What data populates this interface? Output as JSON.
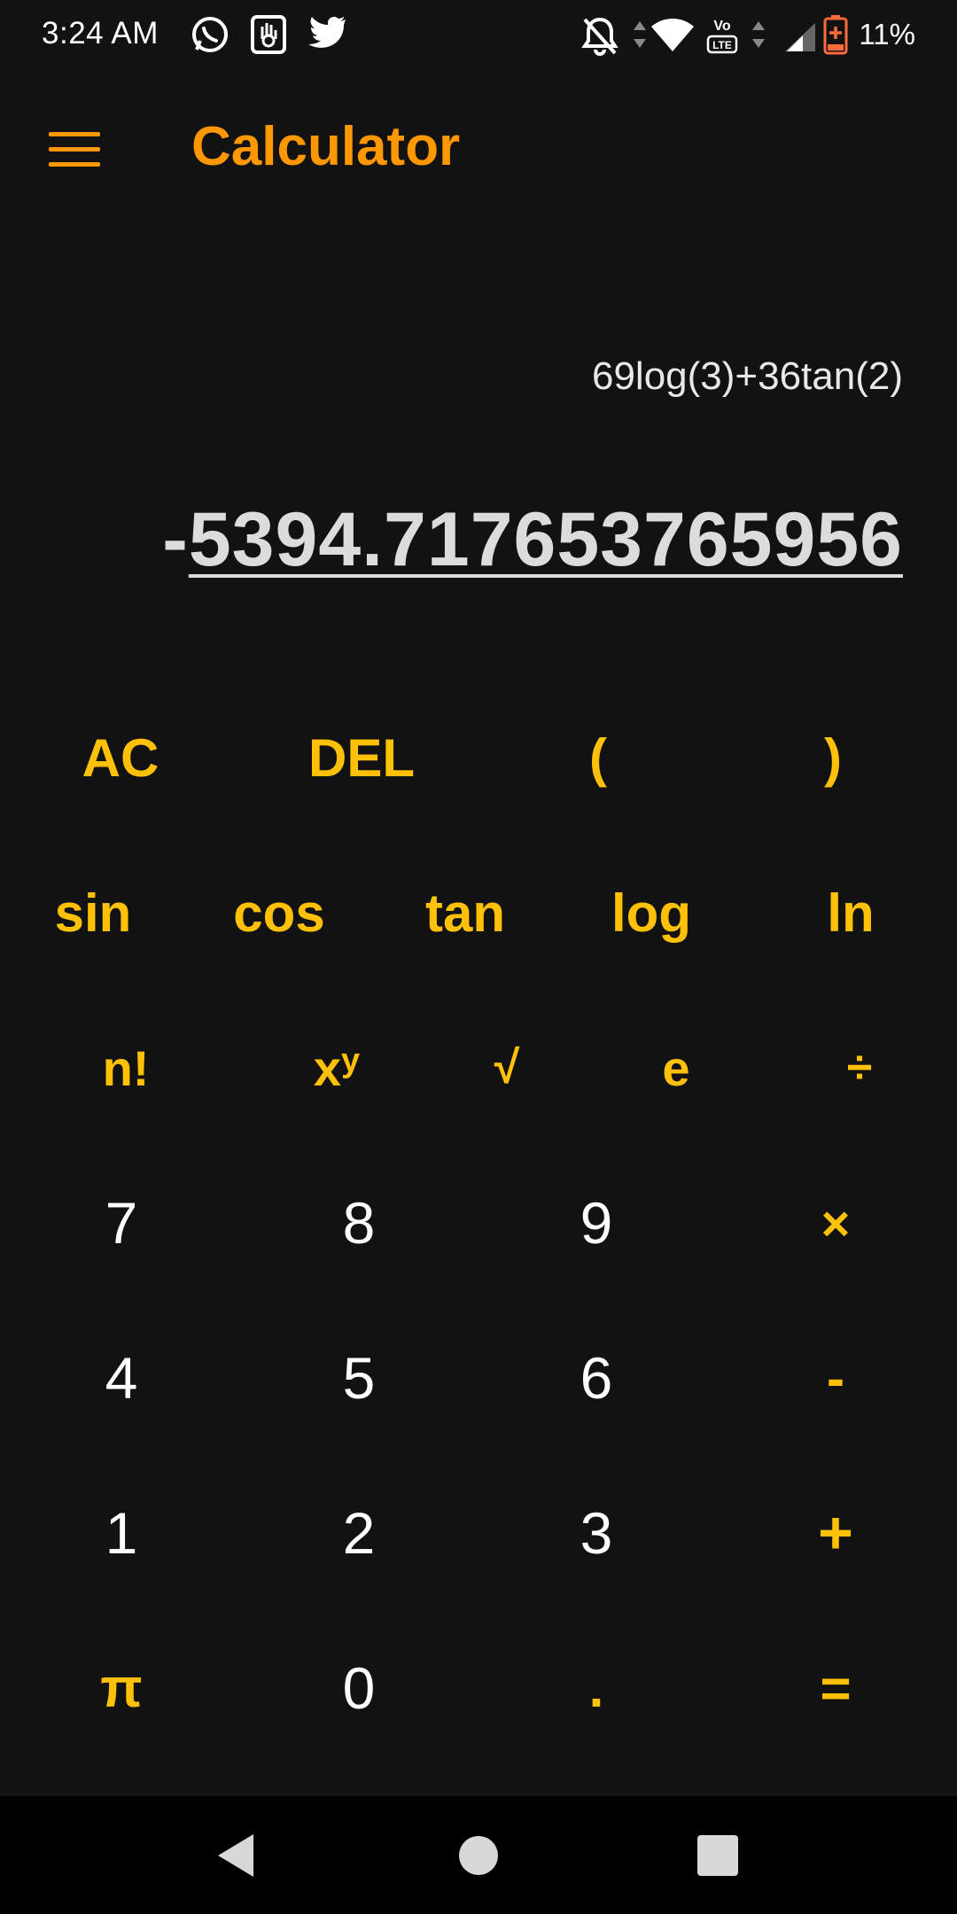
{
  "status_bar": {
    "time": "3:24 AM",
    "battery_percent": "11%",
    "icons": [
      "whatsapp-icon",
      "hand-icon",
      "twitter-icon",
      "notifications-off-icon",
      "data-arrows-icon",
      "wifi-icon",
      "volte-icon",
      "signal-icon",
      "battery-icon"
    ]
  },
  "app_bar": {
    "title": "Calculator",
    "menu_icon": "menu-icon"
  },
  "display": {
    "expression": "69log(3)+36tan(2)",
    "result_sign": "-",
    "result_value": "5394.717653765956"
  },
  "keypad": {
    "row1": [
      "AC",
      "DEL",
      "(",
      ")"
    ],
    "row2": [
      "sin",
      "cos",
      "tan",
      "log",
      "ln"
    ],
    "row3": [
      "n!",
      "x",
      "y",
      "√",
      "e",
      "÷"
    ],
    "row4": [
      "7",
      "8",
      "9",
      "×"
    ],
    "row5": [
      "4",
      "5",
      "6",
      "-"
    ],
    "row6": [
      "1",
      "2",
      "3",
      "+"
    ],
    "row7": [
      "π",
      "0",
      ".",
      "="
    ]
  },
  "nav_bar": {
    "icons": [
      "back-icon",
      "home-icon",
      "recents-icon"
    ]
  },
  "colors": {
    "background": "#121212",
    "title_orange": "#ff9800",
    "key_yellow": "#ffc107",
    "text_white": "#ffffff",
    "nav_black": "#000000"
  }
}
